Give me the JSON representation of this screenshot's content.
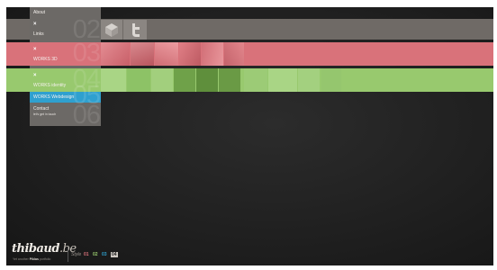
{
  "menu": {
    "about": {
      "label": "About",
      "number": ""
    },
    "links": {
      "label": "Links",
      "number": "02",
      "close": "×"
    },
    "works3d": {
      "label": "WORKS 3D",
      "number": "03",
      "close": "×"
    },
    "identity": {
      "label": "WORKS identity",
      "number": "04",
      "close": "×"
    },
    "webdesign": {
      "label": "WORKS Webdesign",
      "number": "05"
    },
    "contact": {
      "label": "Contact",
      "sub": "let's get in touch",
      "number": "06"
    }
  },
  "footer": {
    "logo_name": "thibaud",
    "logo_domain": ".be",
    "tagline_prefix": "Yet another",
    "tagline_brand": "Piklas",
    "tagline_suffix": "portfolio",
    "style_label": "Style",
    "style_options": [
      "01",
      "02",
      "03",
      "04"
    ]
  },
  "colors": {
    "band_gray": "#6f6a66",
    "band_red": "#d9727a",
    "band_green": "#98c96e",
    "active_blue": "#2fa0cf",
    "style_01": "#d9727a",
    "style_02": "#98c96e",
    "style_03": "#2fa0cf"
  },
  "icons": [
    "cube-icon",
    "twitter-icon"
  ]
}
